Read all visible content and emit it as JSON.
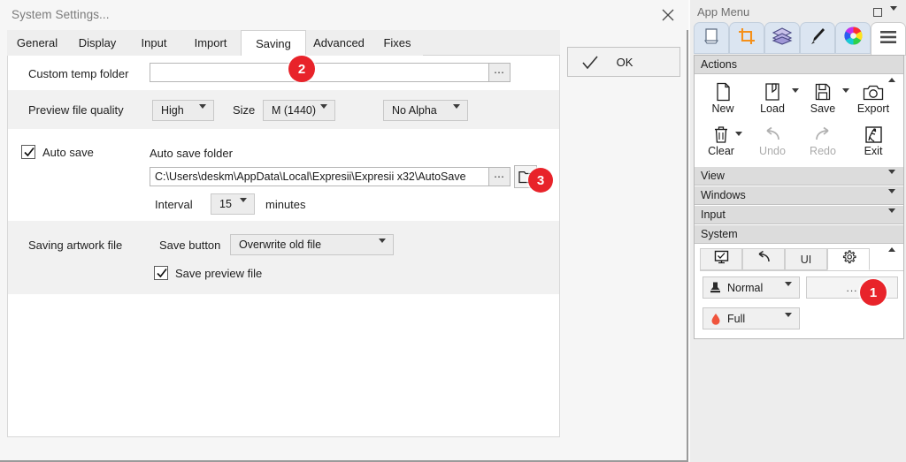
{
  "dialog": {
    "title": "System Settings...",
    "close_icon": "close-icon",
    "tabs": [
      {
        "label": "General",
        "selected": false
      },
      {
        "label": "Display",
        "selected": false
      },
      {
        "label": "Input",
        "selected": false
      },
      {
        "label": "Import",
        "selected": false
      },
      {
        "label": "Saving",
        "selected": true
      },
      {
        "label": "Advanced",
        "selected": false
      },
      {
        "label": "Fixes",
        "selected": false
      }
    ],
    "ok_button": {
      "label": "OK",
      "icon": "check-icon"
    },
    "rows": {
      "temp_folder": {
        "label": "Custom temp folder",
        "value": "",
        "browse_icon": "ellipsis-icon"
      },
      "preview_quality": {
        "label": "Preview file quality",
        "quality_value": "High",
        "size_label": "Size",
        "size_value": "M (1440)",
        "alpha_value": "No Alpha"
      },
      "auto_save": {
        "checkbox_label": "Auto save",
        "checked": true,
        "folder_label": "Auto save folder",
        "folder_path": "C:\\Users\\deskm\\AppData\\Local\\Expresii\\Expresii x32\\AutoSave",
        "browse_icon": "ellipsis-icon",
        "folder_icon": "folder-icon",
        "interval_label": "Interval",
        "interval_value": "15",
        "interval_units": "minutes"
      },
      "saving_artwork": {
        "label": "Saving artwork file",
        "save_button_label": "Save button",
        "save_button_value": "Overwrite old file",
        "preview_checkbox_label": "Save preview file",
        "preview_checked": true
      }
    }
  },
  "app_menu": {
    "title": "App Menu",
    "window_icon": "maximize-icon",
    "caret_icon": "chevron-down-icon",
    "tabs": [
      {
        "icon": "canvas-icon",
        "selected": false
      },
      {
        "icon": "crop-icon",
        "selected": false
      },
      {
        "icon": "layers-icon",
        "selected": false
      },
      {
        "icon": "brush-icon",
        "selected": false
      },
      {
        "icon": "color-wheel-icon",
        "selected": false
      },
      {
        "icon": "hamburger-menu-icon",
        "selected": true
      }
    ],
    "sections": [
      {
        "label": "Actions",
        "expanded": true
      },
      {
        "label": "View",
        "expanded": false
      },
      {
        "label": "Windows",
        "expanded": false
      },
      {
        "label": "Input",
        "expanded": false
      },
      {
        "label": "System",
        "expanded": true
      }
    ],
    "actions": [
      {
        "label": "New",
        "icon": "new-file-icon",
        "disabled": false,
        "has_caret": false
      },
      {
        "label": "Load",
        "icon": "load-folder-icon",
        "disabled": false,
        "has_caret": true
      },
      {
        "label": "Save",
        "icon": "floppy-disk-icon",
        "disabled": false,
        "has_caret": true
      },
      {
        "label": "Export",
        "icon": "camera-icon",
        "disabled": false,
        "has_caret": false
      },
      {
        "label": "Clear",
        "icon": "trash-icon",
        "disabled": false,
        "has_caret": true
      },
      {
        "label": "Undo",
        "icon": "undo-arrow-icon",
        "disabled": true,
        "has_caret": false
      },
      {
        "label": "Redo",
        "icon": "redo-arrow-icon",
        "disabled": true,
        "has_caret": false
      },
      {
        "label": "Exit",
        "icon": "exit-door-icon",
        "disabled": false,
        "has_caret": false
      }
    ],
    "system_tabs": [
      {
        "icon": "monitor-check-icon",
        "selected": false
      },
      {
        "icon": "undo-arrow-icon",
        "selected": false
      },
      {
        "icon": "ui-text-icon",
        "selected": false
      },
      {
        "icon": "gear-icon",
        "selected": true
      }
    ],
    "system_controls": {
      "profile_value": "Normal",
      "profile_icon": "stamp-icon",
      "more_button_label": "...",
      "quality_value": "Full",
      "quality_icon": "droplet-icon"
    }
  },
  "annotations": [
    {
      "number": "1"
    },
    {
      "number": "2"
    },
    {
      "number": "3"
    }
  ],
  "colors": {
    "badge_red": "#e8232a",
    "accent_orange": "#f59019",
    "tab_blue": "#dbe5f1"
  }
}
